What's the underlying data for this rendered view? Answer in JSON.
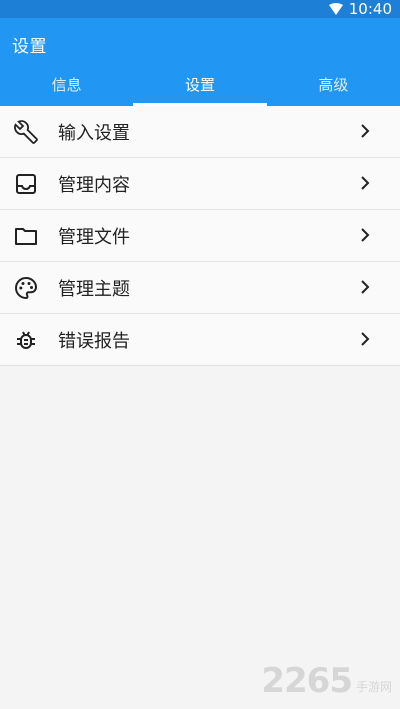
{
  "status_bar": {
    "time": "10:40",
    "icons": [
      "wifi-icon"
    ]
  },
  "app_bar": {
    "title": "设置",
    "tabs": [
      {
        "label": "信息",
        "active": false
      },
      {
        "label": "设置",
        "active": true
      },
      {
        "label": "高级",
        "active": false
      }
    ]
  },
  "settings": {
    "items": [
      {
        "label": "输入设置",
        "icon": "wrench-icon"
      },
      {
        "label": "管理内容",
        "icon": "inbox-icon"
      },
      {
        "label": "管理文件",
        "icon": "folder-icon"
      },
      {
        "label": "管理主题",
        "icon": "palette-icon"
      },
      {
        "label": "错误报告",
        "icon": "bug-icon"
      }
    ]
  },
  "watermark": {
    "number": "2265",
    "site": "手游网"
  },
  "colors": {
    "app_bar": "#2196f3",
    "status_bar": "#1d7fd6",
    "background": "#f4f4f4"
  }
}
